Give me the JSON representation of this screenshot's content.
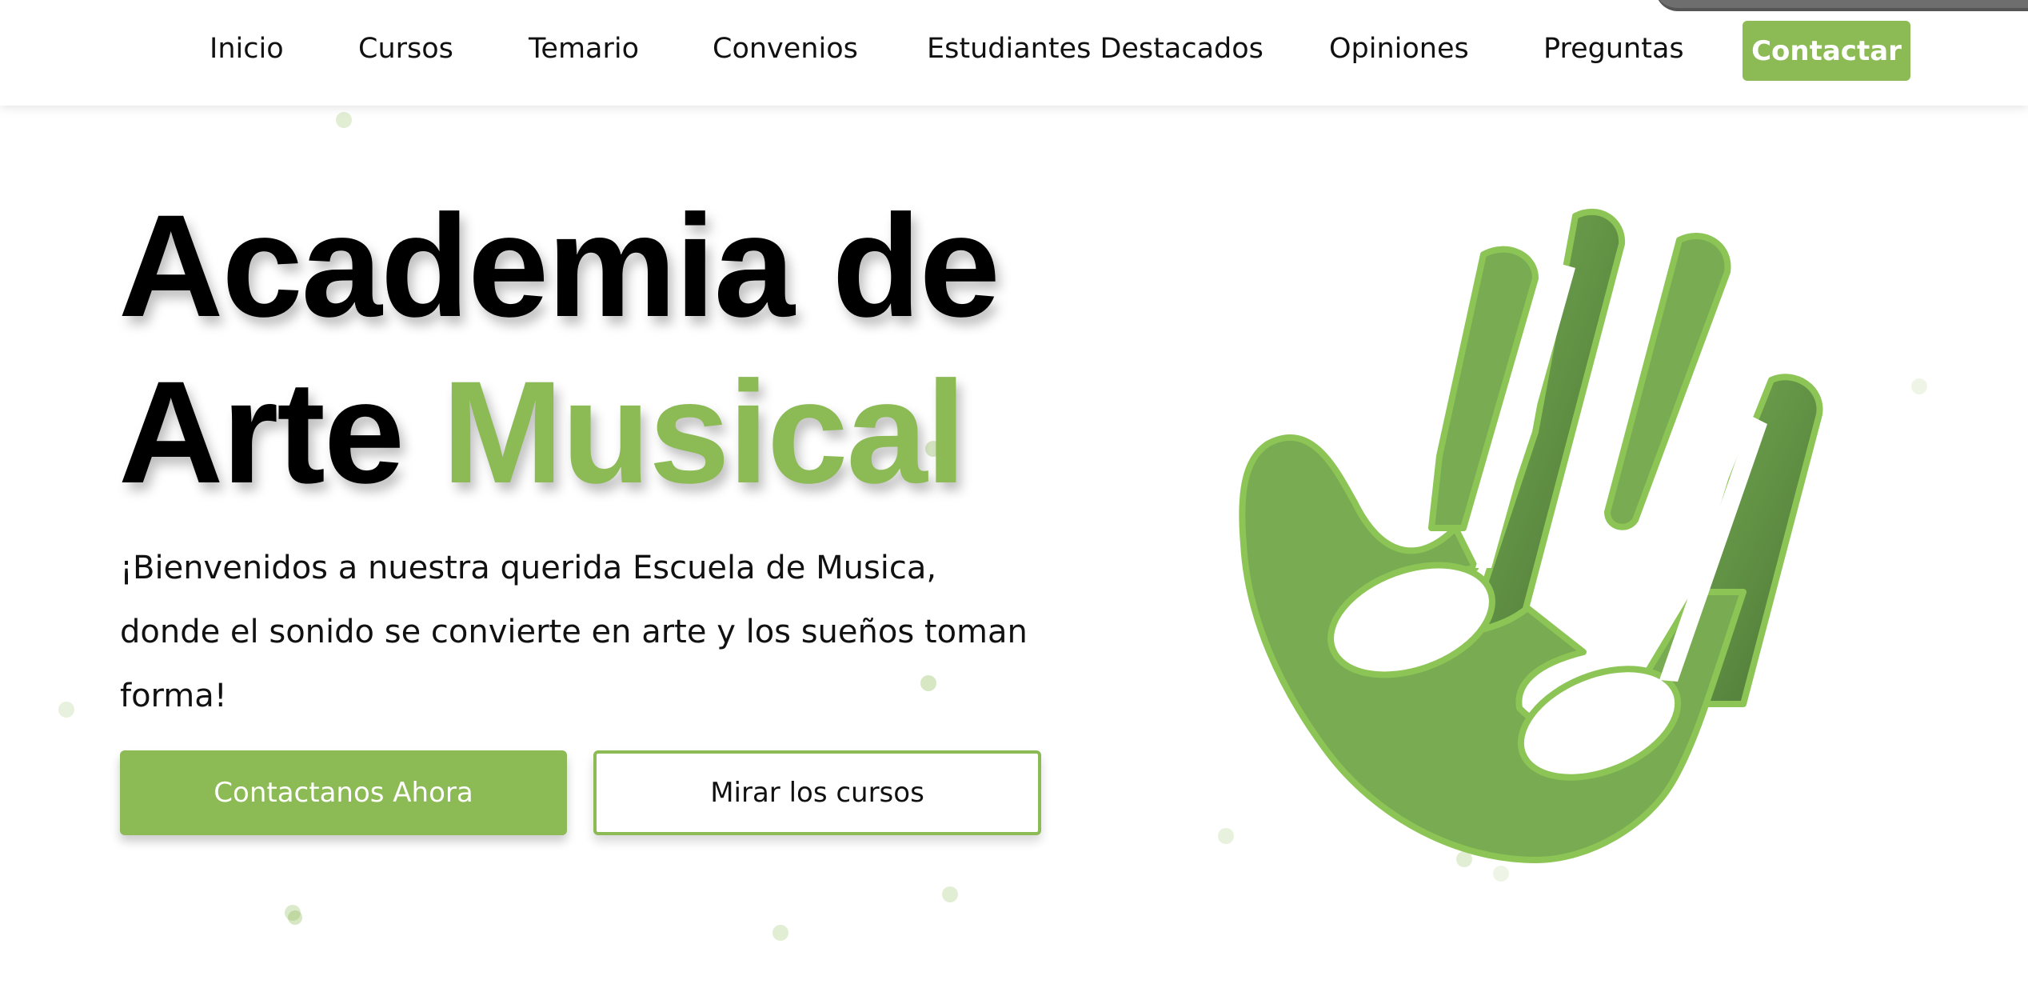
{
  "nav": {
    "items": [
      {
        "label": "Inicio"
      },
      {
        "label": "Cursos"
      },
      {
        "label": "Temario"
      },
      {
        "label": "Convenios"
      },
      {
        "label": "Estudiantes Destacados"
      },
      {
        "label": "Opiniones"
      },
      {
        "label": "Preguntas"
      }
    ],
    "cta_label": "Contactar"
  },
  "hero": {
    "title_line1": "Academia de",
    "title_line2_word": "Arte",
    "title_line2_accent": "Musical",
    "subtitle": "¡Bienvenidos a nuestra querida Escuela de Musica, donde el sonido se convierte en arte y los sueños toman forma!",
    "primary_button": "Contactanos Ahora",
    "secondary_button": "Mirar los cursos"
  },
  "logo_icon": "hand-with-music-notes-icon",
  "colors": {
    "accent": "#8cba55",
    "logo_green": "#79ab53",
    "logo_dark": "#4f7a3a",
    "text": "#111111",
    "background": "#ffffff"
  }
}
